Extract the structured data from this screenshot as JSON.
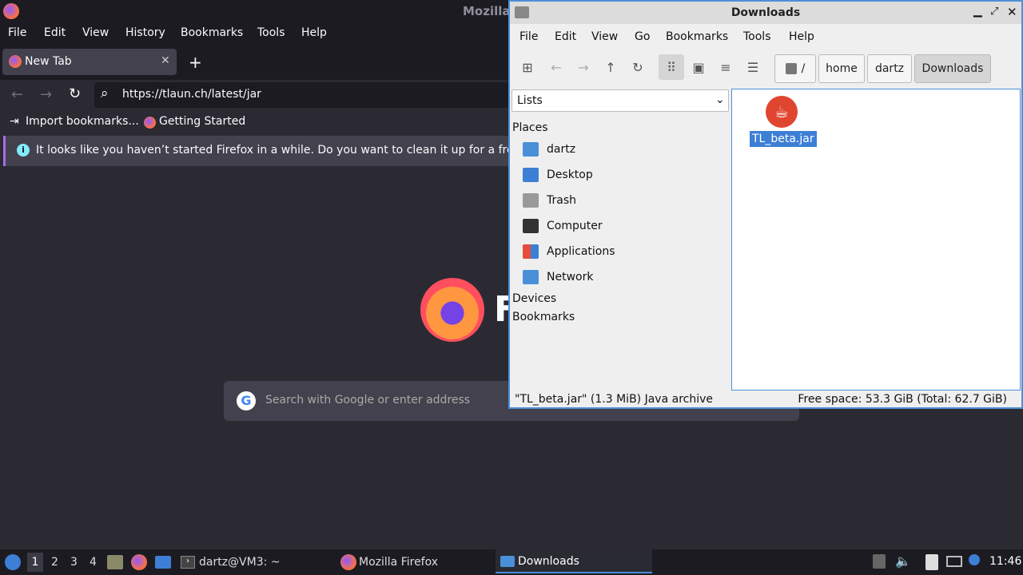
{
  "firefox": {
    "title": "Mozilla",
    "menu": [
      "File",
      "Edit",
      "View",
      "History",
      "Bookmarks",
      "Tools",
      "Help"
    ],
    "tab_label": "New Tab",
    "url": "https://tlaun.ch/latest/jar",
    "bookmarks": [
      "Import bookmarks...",
      "Getting Started"
    ],
    "notice": "It looks like you haven’t started Firefox in a while. Do you want to clean it up for a fresh,",
    "logo_partial": "F",
    "search_placeholder": "Search with Google or enter address"
  },
  "fm": {
    "title": "Downloads",
    "menu": [
      "File",
      "Edit",
      "View",
      "Go",
      "Bookmarks",
      "Tools",
      "Help"
    ],
    "crumbs": [
      "/",
      "home",
      "dartz",
      "Downloads"
    ],
    "side_select": "Lists",
    "places_header": "Places",
    "places": [
      "dartz",
      "Desktop",
      "Trash",
      "Computer",
      "Applications",
      "Network"
    ],
    "devices": "Devices",
    "bookmarks": "Bookmarks",
    "file_name": "TL_beta.jar",
    "status_left": "\"TL_beta.jar\" (1.3 MiB) Java archive",
    "status_right": "Free space: 53.3 GiB (Total: 62.7 GiB)"
  },
  "taskbar": {
    "workspaces": [
      "1",
      "2",
      "3",
      "4"
    ],
    "tasks": [
      "dartz@VM3: ~",
      "Mozilla Firefox",
      "Downloads"
    ],
    "clock": "11:46"
  },
  "colors": {
    "accent": "#4a90d9",
    "firefox_bg": "#2b2a33",
    "selection": "#3d7fd5"
  }
}
